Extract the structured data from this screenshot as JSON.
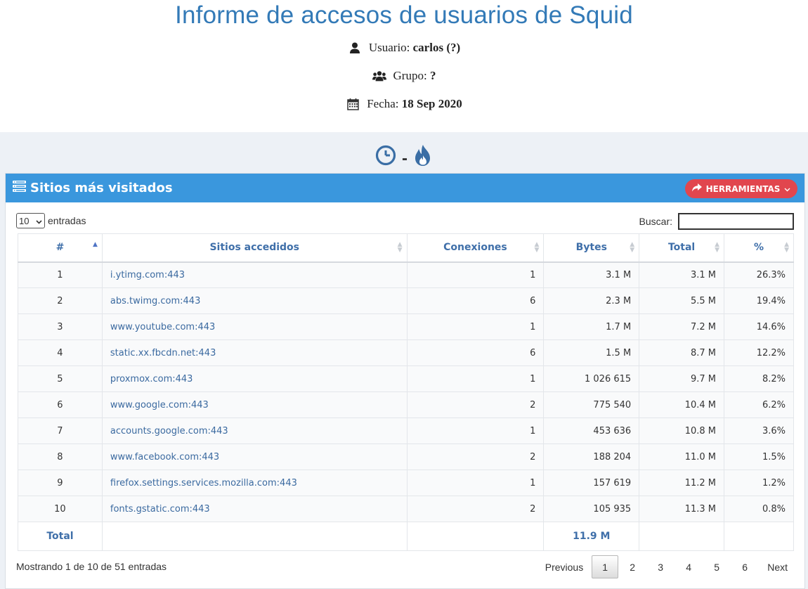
{
  "header": {
    "title": "Informe de accesos de usuarios de Squid",
    "user_label": "Usuario:",
    "user_value": "carlos (?)",
    "group_label": "Grupo:",
    "group_value": "?",
    "date_label": "Fecha:",
    "date_value": "18 Sep 2020"
  },
  "title_icons": {
    "left": "clock-icon",
    "separator": "-",
    "right": "fire-icon",
    "color": "#3a6ea5"
  },
  "panel": {
    "title": "Sitios más visitados",
    "tools_button": "HERRAMIENTAS",
    "head_color": "#3a97dd",
    "button_color": "#e1464e"
  },
  "controls": {
    "length_value": "10",
    "length_suffix": "entradas",
    "search_label": "Buscar:",
    "search_value": ""
  },
  "table": {
    "columns": [
      "#",
      "Sitios accedidos",
      "Conexiones",
      "Bytes",
      "Total",
      "%"
    ],
    "rows": [
      [
        "1",
        "i.ytimg.com:443",
        "1",
        "3.1 M",
        "3.1 M",
        "26.3%"
      ],
      [
        "2",
        "abs.twimg.com:443",
        "6",
        "2.3 M",
        "5.5 M",
        "19.4%"
      ],
      [
        "3",
        "www.youtube.com:443",
        "1",
        "1.7 M",
        "7.2 M",
        "14.6%"
      ],
      [
        "4",
        "static.xx.fbcdn.net:443",
        "6",
        "1.5 M",
        "8.7 M",
        "12.2%"
      ],
      [
        "5",
        "proxmox.com:443",
        "1",
        "1 026 615",
        "9.7 M",
        "8.2%"
      ],
      [
        "6",
        "www.google.com:443",
        "2",
        "775 540",
        "10.4 M",
        "6.2%"
      ],
      [
        "7",
        "accounts.google.com:443",
        "1",
        "453 636",
        "10.8 M",
        "3.6%"
      ],
      [
        "8",
        "www.facebook.com:443",
        "2",
        "188 204",
        "11.0 M",
        "1.5%"
      ],
      [
        "9",
        "firefox.settings.services.mozilla.com:443",
        "1",
        "157 619",
        "11.2 M",
        "1.2%"
      ],
      [
        "10",
        "fonts.gstatic.com:443",
        "2",
        "105 935",
        "11.3 M",
        "0.8%"
      ]
    ],
    "footer": {
      "label": "Total",
      "bytes_total": "11.9 M"
    }
  },
  "footer": {
    "info": "Mostrando 1 de 10 de 51 entradas",
    "pager": {
      "previous": "Previous",
      "pages": [
        "1",
        "2",
        "3",
        "4",
        "5",
        "6"
      ],
      "current": "1",
      "next": "Next"
    }
  }
}
